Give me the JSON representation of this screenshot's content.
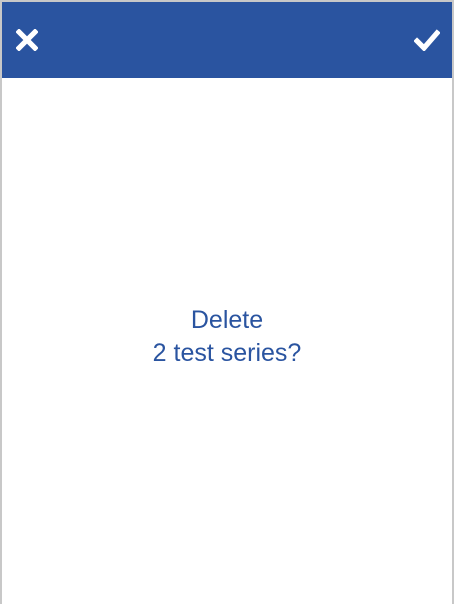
{
  "dialog": {
    "cancel_icon": "close-icon",
    "confirm_icon": "check-icon",
    "message_line1": "Delete",
    "message_line2": "2 test series?"
  },
  "colors": {
    "header_background": "#2a54a0",
    "message_text": "#2a54a0",
    "icon": "#ffffff",
    "background": "#ffffff"
  }
}
